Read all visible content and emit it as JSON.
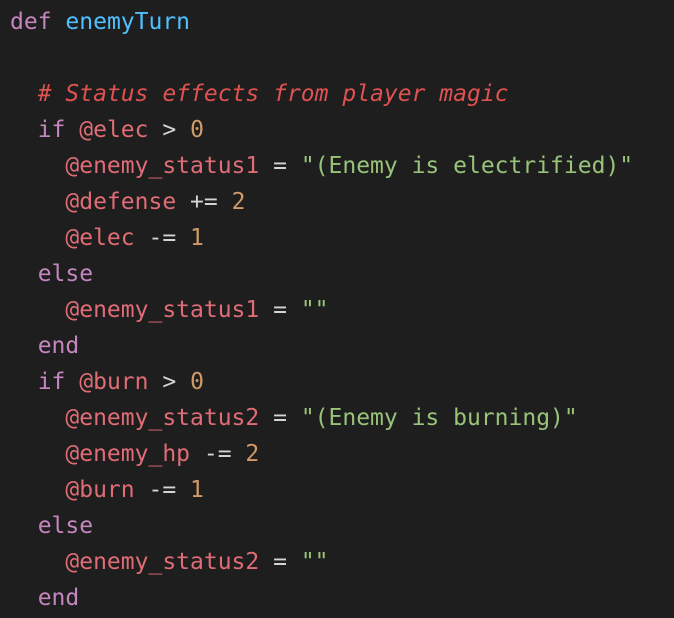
{
  "colors": {
    "background": "#1e1e1e",
    "keyword": "#c586c0",
    "function_name": "#4fc1ff",
    "instance_variable": "#e06c75",
    "number": "#d19a66",
    "string": "#98c379",
    "comment": "#e05252",
    "operator": "#d4d4d4"
  },
  "code": {
    "lines": [
      [
        {
          "t": "kw",
          "v": "def"
        },
        {
          "t": "op",
          "v": " "
        },
        {
          "t": "fn",
          "v": "enemyTurn"
        }
      ],
      [],
      [
        {
          "t": "op",
          "v": "  "
        },
        {
          "t": "cm",
          "v": "# Status effects from player magic"
        }
      ],
      [
        {
          "t": "op",
          "v": "  "
        },
        {
          "t": "kw",
          "v": "if"
        },
        {
          "t": "op",
          "v": " "
        },
        {
          "t": "iv",
          "v": "@elec"
        },
        {
          "t": "op",
          "v": " > "
        },
        {
          "t": "num",
          "v": "0"
        }
      ],
      [
        {
          "t": "op",
          "v": "    "
        },
        {
          "t": "iv",
          "v": "@enemy_status1"
        },
        {
          "t": "op",
          "v": " = "
        },
        {
          "t": "str",
          "v": "\"(Enemy is electrified)\""
        }
      ],
      [
        {
          "t": "op",
          "v": "    "
        },
        {
          "t": "iv",
          "v": "@defense"
        },
        {
          "t": "op",
          "v": " += "
        },
        {
          "t": "num",
          "v": "2"
        }
      ],
      [
        {
          "t": "op",
          "v": "    "
        },
        {
          "t": "iv",
          "v": "@elec"
        },
        {
          "t": "op",
          "v": " -= "
        },
        {
          "t": "num",
          "v": "1"
        }
      ],
      [
        {
          "t": "op",
          "v": "  "
        },
        {
          "t": "kw",
          "v": "else"
        }
      ],
      [
        {
          "t": "op",
          "v": "    "
        },
        {
          "t": "iv",
          "v": "@enemy_status1"
        },
        {
          "t": "op",
          "v": " = "
        },
        {
          "t": "str",
          "v": "\"\""
        }
      ],
      [
        {
          "t": "op",
          "v": "  "
        },
        {
          "t": "kw",
          "v": "end"
        }
      ],
      [
        {
          "t": "op",
          "v": "  "
        },
        {
          "t": "kw",
          "v": "if"
        },
        {
          "t": "op",
          "v": " "
        },
        {
          "t": "iv",
          "v": "@burn"
        },
        {
          "t": "op",
          "v": " > "
        },
        {
          "t": "num",
          "v": "0"
        }
      ],
      [
        {
          "t": "op",
          "v": "    "
        },
        {
          "t": "iv",
          "v": "@enemy_status2"
        },
        {
          "t": "op",
          "v": " = "
        },
        {
          "t": "str",
          "v": "\"(Enemy is burning)\""
        }
      ],
      [
        {
          "t": "op",
          "v": "    "
        },
        {
          "t": "iv",
          "v": "@enemy_hp"
        },
        {
          "t": "op",
          "v": " -= "
        },
        {
          "t": "num",
          "v": "2"
        }
      ],
      [
        {
          "t": "op",
          "v": "    "
        },
        {
          "t": "iv",
          "v": "@burn"
        },
        {
          "t": "op",
          "v": " -= "
        },
        {
          "t": "num",
          "v": "1"
        }
      ],
      [
        {
          "t": "op",
          "v": "  "
        },
        {
          "t": "kw",
          "v": "else"
        }
      ],
      [
        {
          "t": "op",
          "v": "    "
        },
        {
          "t": "iv",
          "v": "@enemy_status2"
        },
        {
          "t": "op",
          "v": " = "
        },
        {
          "t": "str",
          "v": "\"\""
        }
      ],
      [
        {
          "t": "op",
          "v": "  "
        },
        {
          "t": "kw",
          "v": "end"
        }
      ]
    ]
  }
}
